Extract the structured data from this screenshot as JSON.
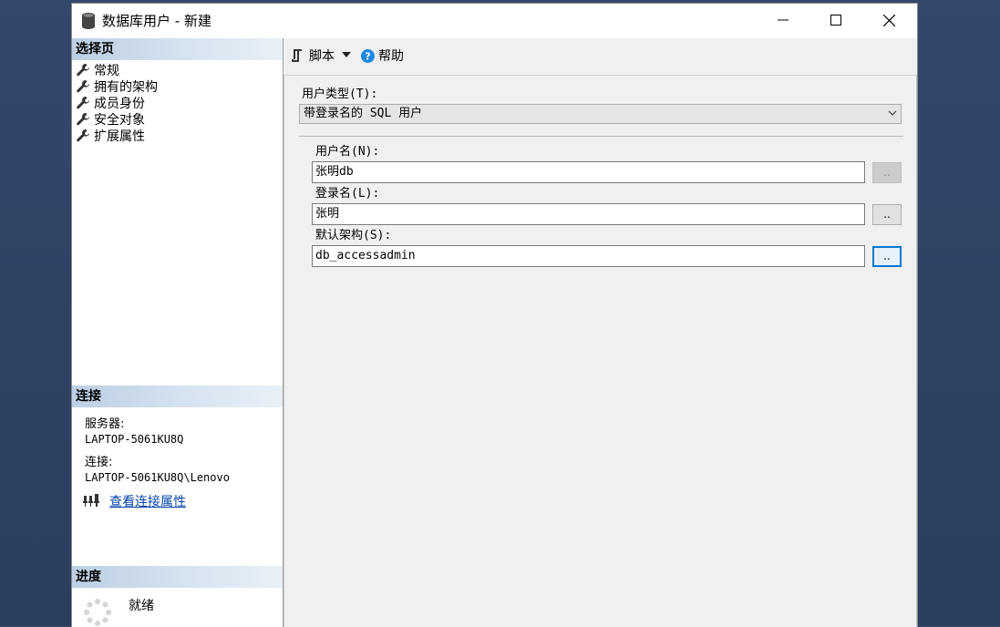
{
  "window": {
    "title": "数据库用户 - 新建"
  },
  "left": {
    "select_page_header": "选择页",
    "pages": [
      {
        "label": "常规"
      },
      {
        "label": "拥有的架构"
      },
      {
        "label": "成员身份"
      },
      {
        "label": "安全对象"
      },
      {
        "label": "扩展属性"
      }
    ],
    "connection_header": "连接",
    "server_label": "服务器:",
    "server_value": "LAPTOP-5061KU8Q",
    "connection_label": "连接:",
    "connection_value": "LAPTOP-5061KU8Q\\Lenovo",
    "view_connection_link": "查看连接属性",
    "progress_header": "进度",
    "progress_status": "就绪"
  },
  "toolbar": {
    "script_label": "脚本",
    "help_label": "帮助"
  },
  "form": {
    "user_type_label": "用户类型(T):",
    "user_type_value": "带登录名的 SQL 用户",
    "user_name_label": "用户名(N):",
    "user_name_value": "张明db",
    "login_name_label": "登录名(L):",
    "login_name_value": "张明",
    "default_schema_label": "默认架构(S):",
    "default_schema_value": "db_accessadmin",
    "browse_label": ".."
  },
  "colors": {
    "desktop": "#33476b",
    "section_header": "#bccfe4",
    "link": "#0645ad",
    "focus": "#0078d7",
    "help_icon": "#1e88e5"
  }
}
